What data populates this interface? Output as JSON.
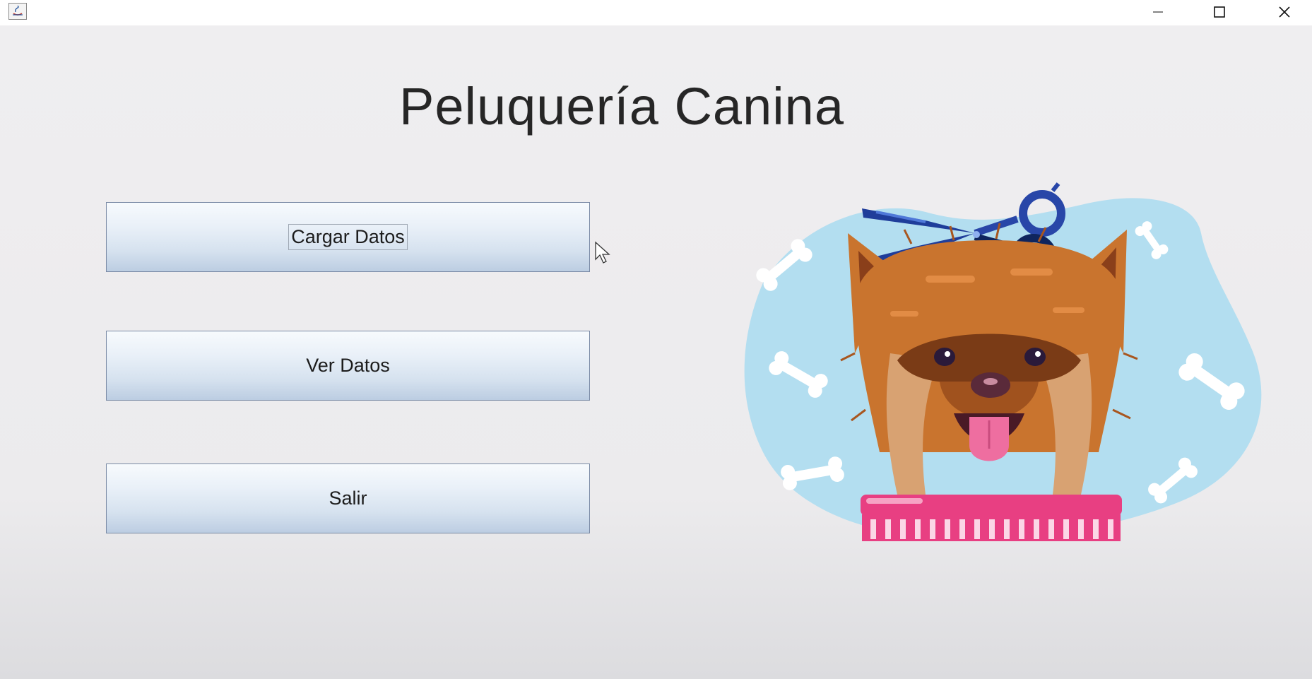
{
  "window": {
    "title_icon": "java-icon",
    "controls": [
      "minimize-icon",
      "maximize-icon",
      "close-icon"
    ]
  },
  "main": {
    "title": "Peluquería Canina",
    "buttons": [
      {
        "label": "Cargar Datos",
        "focused": true
      },
      {
        "label": "Ver Datos",
        "focused": false
      },
      {
        "label": "Salir",
        "focused": false
      }
    ]
  },
  "colors": {
    "blob": "#b3def0",
    "bone": "#ffffff",
    "scissors": "#1f3d9a",
    "dog_fur": "#c9742e",
    "comb": "#e83f82",
    "tongue": "#ee6ea0"
  }
}
